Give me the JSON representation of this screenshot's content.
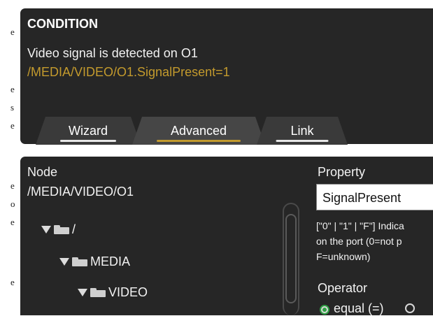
{
  "side_letters": [
    "e",
    "e",
    "s",
    "e",
    "e",
    "o",
    "e",
    "e"
  ],
  "condition": {
    "title": "CONDITION",
    "description": "Video signal is detected on O1",
    "path": "/MEDIA/VIDEO/O1.SignalPresent=1"
  },
  "tabs": [
    {
      "label": "Wizard",
      "active": false
    },
    {
      "label": "Advanced",
      "active": true
    },
    {
      "label": "Link",
      "active": false
    }
  ],
  "node": {
    "label": "Node",
    "path": "/MEDIA/VIDEO/O1",
    "tree": [
      {
        "label": "/",
        "icon": "folder-icon",
        "expanded": true
      },
      {
        "label": "MEDIA",
        "icon": "folder-icon",
        "expanded": true
      },
      {
        "label": "VIDEO",
        "icon": "folder-icon",
        "expanded": true
      }
    ]
  },
  "property": {
    "label": "Property",
    "value": "SignalPresent",
    "help_line1": "[\"0\" | \"1\" | \"F\"] Indica",
    "help_line2": "on the port (0=not p",
    "help_line3": "F=unknown)"
  },
  "operator": {
    "label": "Operator",
    "selected_option": "equal (=)"
  },
  "colors": {
    "panel_bg": "#262626",
    "accent": "#c39a2d",
    "radio_selected": "#2ea043"
  }
}
